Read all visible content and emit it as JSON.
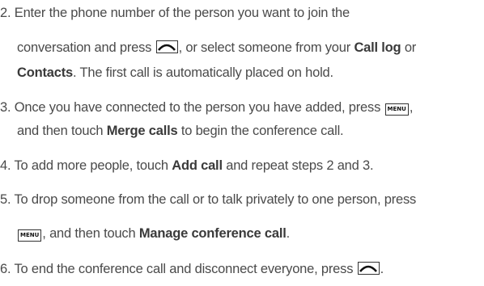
{
  "steps": [
    {
      "num": "2.",
      "line1": "Enter the phone number of the person you want to join the",
      "line2_pre": "conversation and press ",
      "line2_mid": ", or select someone from your ",
      "call_log": "Call log",
      "or": " or",
      "contacts": "Contacts",
      "line3_post": ". The first call is automatically placed on hold."
    },
    {
      "num": "3.",
      "line1_pre": "Once you have connected to the person you have added, press ",
      "line1_post": ",",
      "line2_pre": "and then touch ",
      "merge": "Merge calls",
      "line2_post": " to begin the conference call."
    },
    {
      "num": "4.",
      "pre": "To add more people, touch ",
      "add_call": "Add call",
      "post": " and repeat steps 2 and 3."
    },
    {
      "num": "5.",
      "line1": "To drop someone from the call or to talk privately to one person, press",
      "line2_mid": ", and then touch ",
      "manage": "Manage conference call",
      "line2_post": "."
    },
    {
      "num": "6.",
      "pre": "To end the conference call and disconnect everyone, press ",
      "post": "."
    }
  ],
  "keys": {
    "menu_label": "MENU",
    "call_icon": "call-key-icon"
  }
}
